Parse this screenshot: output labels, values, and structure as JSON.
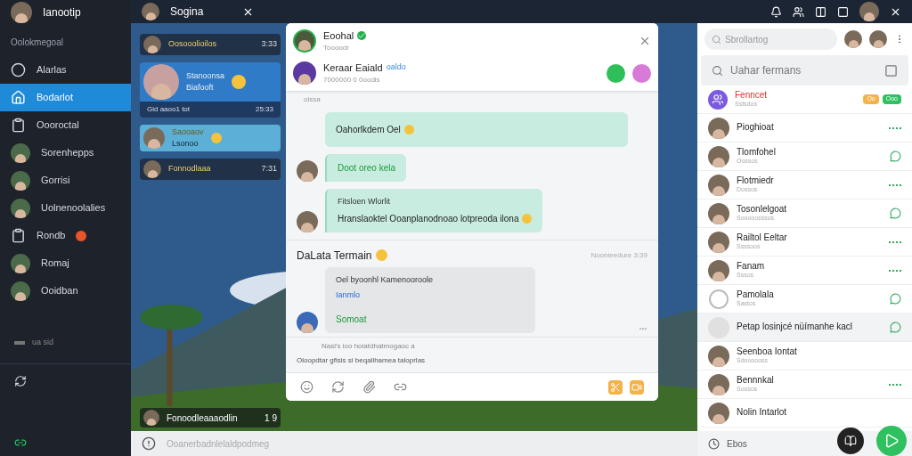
{
  "sidebar": {
    "user": {
      "name": "Ianootip"
    },
    "section": "Oolokmegoal",
    "items": [
      {
        "label": "Alarlas",
        "kind": "icon",
        "selected": false,
        "emoji": false
      },
      {
        "label": "Bodarlot",
        "kind": "icon",
        "selected": true,
        "emoji": false
      },
      {
        "label": "Oooroctal",
        "kind": "icon",
        "selected": false,
        "emoji": false
      },
      {
        "label": "Sorenhepps",
        "kind": "avatar",
        "selected": false,
        "emoji": false
      },
      {
        "label": "Gorrisi",
        "kind": "avatar",
        "selected": false,
        "emoji": false
      },
      {
        "label": "Uolnenoolalies",
        "kind": "avatar",
        "selected": false,
        "emoji": false
      },
      {
        "label": "Rondb",
        "kind": "icon",
        "selected": false,
        "emoji": true
      },
      {
        "label": "Romaj",
        "kind": "avatar",
        "selected": false,
        "emoji": false
      },
      {
        "label": "Ooidban",
        "kind": "avatar",
        "selected": false,
        "emoji": false
      }
    ],
    "footer": "ua  sid"
  },
  "topbar": {
    "title": "Sogina"
  },
  "chats": [
    {
      "kind": "strip",
      "name": "Oosooolioilos",
      "time": "3:33"
    },
    {
      "kind": "card",
      "name": "Stanoonsa",
      "preview": "Biafooft",
      "note": "Gid aaoo1 tot",
      "time": "25:33"
    },
    {
      "kind": "light",
      "name": "Saooaov",
      "preview": "Lsonoo"
    },
    {
      "kind": "strip",
      "name": "Fonnodlaaa",
      "time": "7:31"
    }
  ],
  "bottom_chat": {
    "name": "Fonoodleaaaodlin",
    "count": "1 9"
  },
  "composer": {
    "placeholder": "Ooanerbadnlelaldpodmeg"
  },
  "dialog": {
    "contacts": [
      {
        "name": "Eoohal",
        "status": "Toooodr",
        "verified": true
      },
      {
        "name": "Keraar Eaiald",
        "status": "7000000 0 0oodis",
        "verified": false,
        "tag": "oaldo"
      }
    ],
    "day": "oissa",
    "messages": [
      {
        "text": "Oahorlkdem Oel",
        "avatar": false
      },
      {
        "text": "Doot oreo kela",
        "avatar": true
      },
      {
        "text": "Hranslaoktel Ooanplanodnoao lotpreoda ilona",
        "avatar": true,
        "title": "Fitsloen Wlorlit"
      }
    ],
    "section": {
      "title": "DaLata Termain",
      "time": "Noonieedure 3:39",
      "lines": [
        "Oel byoonhl Kamenooroole",
        "Ianmlo",
        "Somoat"
      ]
    },
    "notes": [
      "Nasi's ioo hoiatdhatmogaoc a",
      "Oloopdtar gfisis si  beqalihamea taloprlas"
    ]
  },
  "panel": {
    "search": {
      "placeholder": "Sbrollartog"
    },
    "search2": {
      "placeholder": "Uahar fermans"
    },
    "contacts": [
      {
        "name": "Fenncet",
        "sub": "Sstsdos",
        "kind": "group",
        "action": {
          "kind": "badges",
          "badges": [
            "Oo",
            "Ooo"
          ]
        },
        "selected": false
      },
      {
        "name": "Pioghioat",
        "kind": "avatar",
        "action": {
          "kind": "dots"
        },
        "selected": false
      },
      {
        "name": "Tlomfohel",
        "sub": "Oossos",
        "kind": "avatar",
        "action": {
          "kind": "chat"
        },
        "selected": false
      },
      {
        "name": "Flotmiedr",
        "sub": "Dossos",
        "kind": "avatar",
        "action": {
          "kind": "dots"
        },
        "selected": false
      },
      {
        "name": "Tosonlelgoat",
        "sub": "Sooooosssos",
        "kind": "avatar",
        "action": {
          "kind": "chat"
        },
        "selected": false
      },
      {
        "name": "Railtol Eeltar",
        "sub": "Ssssoos",
        "kind": "avatar",
        "action": {
          "kind": "dots"
        },
        "selected": false
      },
      {
        "name": "Fanam",
        "sub": "Sssos",
        "kind": "avatar",
        "action": {
          "kind": "dots"
        },
        "selected": false
      },
      {
        "name": "Pamolala",
        "sub": "Sastos",
        "kind": "outline",
        "action": {
          "kind": "chat"
        },
        "selected": false
      },
      {
        "name": "Petap losinjcé nüímanhe kacl",
        "kind": "placeholder",
        "action": {
          "kind": "chat"
        },
        "selected": true
      },
      {
        "name": "Seenboa Iontat",
        "sub": "Sdoooooss",
        "kind": "avatar",
        "selected": false
      },
      {
        "name": "Bennnkal",
        "sub": "Soosos",
        "kind": "avatar",
        "action": {
          "kind": "dots"
        },
        "selected": false
      },
      {
        "name": "Nolin Intarlot",
        "kind": "avatar",
        "selected": false
      }
    ],
    "input": {
      "placeholder": "Ebos"
    }
  }
}
